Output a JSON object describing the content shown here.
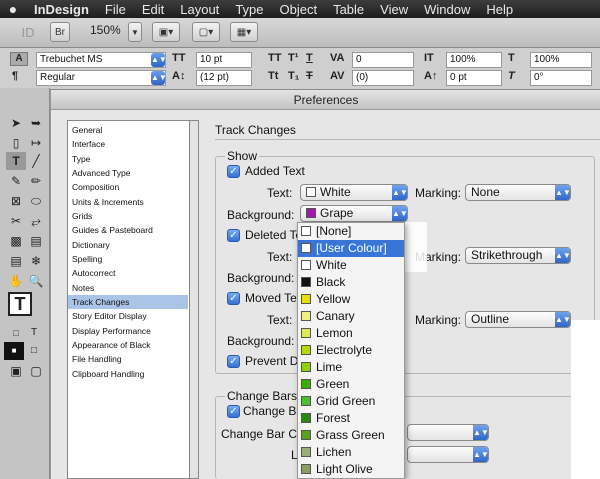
{
  "menubar": {
    "apple": "",
    "items": [
      "InDesign",
      "File",
      "Edit",
      "Layout",
      "Type",
      "Object",
      "Table",
      "View",
      "Window",
      "Help"
    ]
  },
  "appbar": {
    "logo": "ID",
    "bridge": "Br",
    "zoom": "150%"
  },
  "control": {
    "font_family": "Trebuchet MS",
    "font_style": "Regular",
    "size": "10 pt",
    "leading": "(12 pt)",
    "kerning": "0",
    "tracking": "(0)",
    "vscale": "100%",
    "hscale": "100%",
    "baseline": "0 pt",
    "skew": "0°"
  },
  "dialog": {
    "title": "Preferences",
    "sidebar": [
      "General",
      "Interface",
      "Type",
      "Advanced Type",
      "Composition",
      "Units & Increments",
      "Grids",
      "Guides & Pasteboard",
      "Dictionary",
      "Spelling",
      "Autocorrect",
      "Notes",
      "Track Changes",
      "Story Editor Display",
      "Display Performance",
      "Appearance of Black",
      "File Handling",
      "Clipboard Handling"
    ],
    "selected": "Track Changes",
    "panel_title": "Track Changes",
    "show_label": "Show",
    "added_text": "Added Text",
    "deleted_text": "Deleted Te",
    "moved_text": "Moved Tex",
    "prevent": "Prevent Du",
    "text_label": "Text:",
    "background_label": "Background:",
    "marking_label": "Marking:",
    "added_text_color": "White",
    "added_bg_color": "Grape",
    "added_marking": "None",
    "deleted_marking": "Strikethrough",
    "moved_marking": "Outline",
    "change_bars": "Change Bars",
    "change_bars_cb": "Change Ba",
    "change_bar_color": "Change Bar Co",
    "location": "Loc"
  },
  "popup": {
    "items": [
      {
        "label": "[None]",
        "color": "#ffffff"
      },
      {
        "label": "[User Colour]",
        "color": "#ffffff"
      },
      {
        "label": "White",
        "color": "#ffffff"
      },
      {
        "label": "Black",
        "color": "#111111"
      },
      {
        "label": "Yellow",
        "color": "#e8e000"
      },
      {
        "label": "Canary",
        "color": "#f0f080"
      },
      {
        "label": "Lemon",
        "color": "#dfe85a"
      },
      {
        "label": "Electrolyte",
        "color": "#b6d800"
      },
      {
        "label": "Lime",
        "color": "#8ed000"
      },
      {
        "label": "Green",
        "color": "#38b000"
      },
      {
        "label": "Grid Green",
        "color": "#48c030"
      },
      {
        "label": "Forest",
        "color": "#2a8a10"
      },
      {
        "label": "Grass Green",
        "color": "#5aa020"
      },
      {
        "label": "Lichen",
        "color": "#9ab070"
      },
      {
        "label": "Light Olive",
        "color": "#8aa060"
      }
    ],
    "highlighted": "[User Colour]"
  },
  "colors": {
    "grape": "#a01aa8",
    "accent": "#3875d7"
  }
}
